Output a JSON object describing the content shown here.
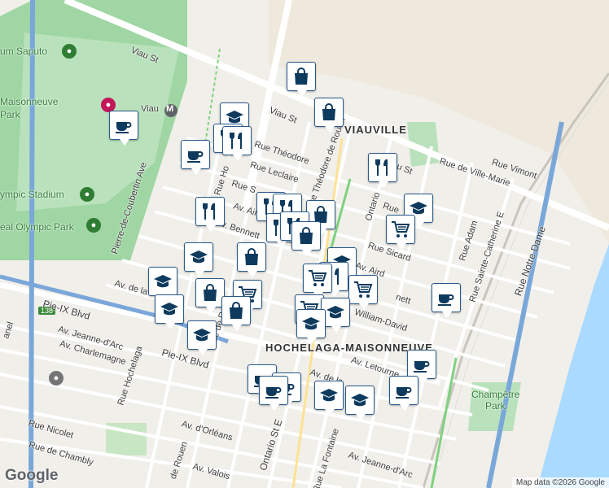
{
  "map": {
    "attribution": "Map data ©2026 Google",
    "logo": "Google",
    "metro": {
      "name": "Viau",
      "symbol": "M"
    },
    "route_shield": "138",
    "neighborhoods": [
      "VIAUVILLE",
      "HOCHELAGA-MAISONNEUVE"
    ],
    "parks": [
      "Maisonneuve Park",
      "Olympic Stadium",
      "Olympic Park",
      "Stadium Saputo",
      "Champêtre Park"
    ],
    "park_parts": {
      "maisonneuve": "Maisonneuve",
      "park": "Park",
      "stadium_saputo": "um Saputo",
      "olympic_stadium": "ympic Stadium",
      "olympic_park": "eal Olympic Park",
      "champetre": "Champêtre",
      "champetre_park": "Park"
    },
    "streets": {
      "viau_top": "Viau St",
      "viau_mid": "Viau St",
      "viau_right": "u St",
      "theodore": "Rue Théodore",
      "theodore_rouen": "Rue Théodore de Rouen",
      "leclaire": "Rue Leclaire",
      "rue_s": "Rue S",
      "airlie": "Av. Air",
      "bennett": "Av. Bennett",
      "sicard": "Rue Sicard",
      "aird": "Av. Aird",
      "bennett_right": "nett",
      "william_david": "William-David",
      "letourneux": "Av. Letourne",
      "de_la": "Av. de la",
      "jeanne": "Av. Jeanne-d'Arc",
      "charlemagne": "Av. Charlemagne",
      "pie_ix_1": "Pie-IX Blvd",
      "pie_ix_2": "Pie-IX Blvd",
      "nicolet": "Rue Nicolet",
      "chambly": "Rue de Chambly",
      "orleans": "Av. d'Orléans",
      "valois": "Av. Valois",
      "rouen_bottom": "de Rouen",
      "ontario_bottom": "Ontario St E",
      "la_fontaine": "Rue La Fontaine",
      "jeanne_bottom": "Av. Jeanne-d'Arc",
      "hochelaga": "Rue Hochelaga",
      "pierre": "Pierre-de-Coubertin Ave",
      "rue_ho": "Rue Ho",
      "ontario": "Ontario",
      "rue_r": "Rue de R",
      "ville_marie": "Rue de Ville-Marie",
      "vimont": "Rue Vimont",
      "adam": "Rue Adam",
      "ste_catherine": "Rue Sainte-Catherine E",
      "notre_dame": "Rue Notre Dame",
      "chapman": "Rue",
      "ore": "ore",
      "anel": "anel"
    },
    "legend_icons": [
      "coffee-icon",
      "restaurant-icon",
      "shopping-bag-icon",
      "shopping-cart-icon",
      "school-icon"
    ]
  }
}
